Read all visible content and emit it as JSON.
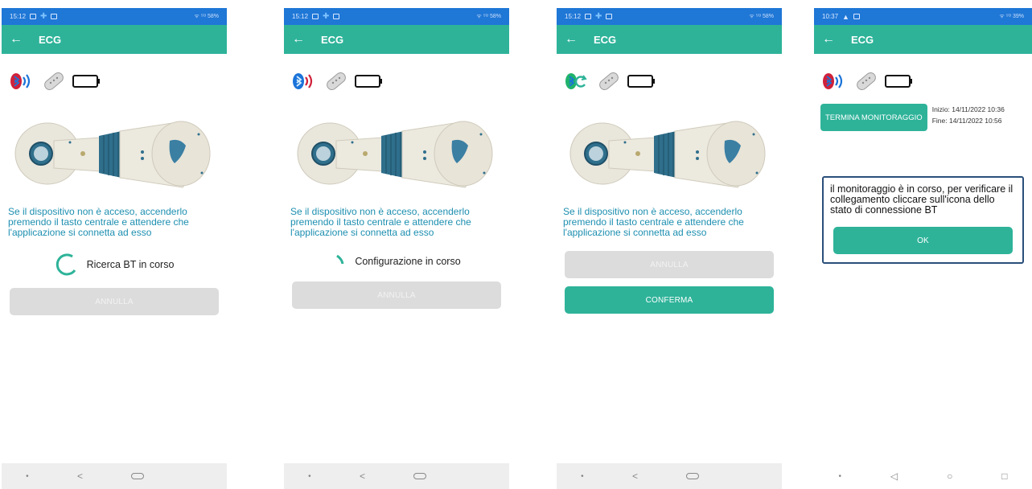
{
  "screens": [
    {
      "status": {
        "time": "15:12",
        "right": "ᯤ ⁵ᴳ 58%"
      },
      "app": {
        "back": "←",
        "title": "ECG"
      },
      "hint": "Se il dispositivo non è acceso, accenderlo premendo il tasto centrale e attendere che l'applicazione si connetta ad esso",
      "progress_text": "Ricerca BT in corso",
      "cancel_label": "ANNULLA"
    },
    {
      "status": {
        "time": "15:12",
        "right": "ᯤ ⁵ᴳ 58%"
      },
      "app": {
        "back": "←",
        "title": "ECG"
      },
      "hint": "Se il dispositivo non è acceso, accenderlo premendo il tasto centrale e attendere che l'applicazione si connetta ad esso",
      "progress_text": "Configurazione in corso",
      "cancel_label": "ANNULLA"
    },
    {
      "status": {
        "time": "15:12",
        "right": "ᯤ ⁵ᴳ 58%"
      },
      "app": {
        "back": "←",
        "title": "ECG"
      },
      "hint": "Se il dispositivo non è acceso, accenderlo premendo il tasto centrale e attendere che l'applicazione si connetta ad esso",
      "cancel_label": "ANNULLA",
      "confirm_label": "CONFERMA"
    },
    {
      "status": {
        "time": "10:37",
        "right": "ᯤ ⁵ᴳ 39%"
      },
      "app": {
        "back": "←",
        "title": "ECG"
      },
      "terminate_label": "TERMINA MONITORAGGIO",
      "start": "Inizio: 14/11/2022 10:36",
      "end": "Fine: 14/11/2022 10:56",
      "dialog_text": "il monitoraggio è in corso, per verificare il collegamento cliccare sull'icona dello stato di connessione BT",
      "ok_label": "OK"
    }
  ],
  "nav": {
    "back": "<",
    "recent_back": "◁",
    "home_circle": "○",
    "square": "□",
    "dot": "•"
  },
  "colors": {
    "accent": "#2eb399",
    "statusbar": "#1f77d6",
    "hint": "#1d8fb0",
    "bt_red": "#d0213a",
    "bt_blue": "#1a73d9"
  },
  "icons": {
    "bluetooth": "bluetooth-icon",
    "patch": "ecg-patch-icon",
    "battery": "battery-icon"
  }
}
